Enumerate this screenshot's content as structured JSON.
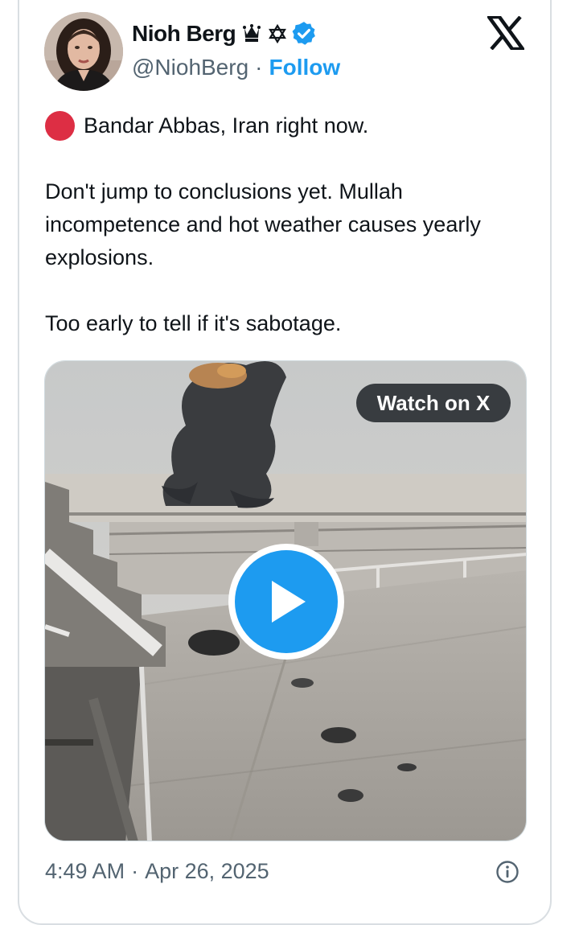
{
  "author": {
    "display_name": "Nioh Berg",
    "handle": "@NiohBerg",
    "separator": "·",
    "follow_label": "Follow",
    "name_badges": [
      "crown-icon",
      "star-of-david-icon",
      "verified-badge-icon"
    ]
  },
  "tweet": {
    "line1": "Bandar Abbas, Iran right now.",
    "line1_icon": "red-circle-icon",
    "para2": "Don't jump to conclusions yet. Mullah incompetence and hot weather causes yearly explosions.",
    "para3": "Too early to tell if it's sabotage."
  },
  "media": {
    "watch_label": "Watch on X",
    "play_icon": "play-icon"
  },
  "footer": {
    "time": "4:49 AM",
    "separator": "·",
    "date": "Apr 26, 2025",
    "info_icon": "info-icon"
  },
  "colors": {
    "accent": "#1d9bf0",
    "text": "#0f1419",
    "muted": "#536471",
    "border": "#d9dee2",
    "red_circle": "#dd2e44"
  }
}
